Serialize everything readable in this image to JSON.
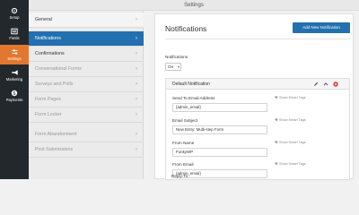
{
  "header": {
    "title": "Settings"
  },
  "rail": {
    "items": [
      {
        "label": "Setup",
        "icon": "gear-icon"
      },
      {
        "label": "Fields",
        "icon": "fields-icon"
      },
      {
        "label": "Settings",
        "icon": "sliders-icon"
      },
      {
        "label": "Marketing",
        "icon": "megaphone-icon"
      },
      {
        "label": "Payments",
        "icon": "dollar-icon"
      }
    ],
    "active_color": "#e27730",
    "background": "#23282d"
  },
  "subnav": {
    "items": [
      {
        "label": "General"
      },
      {
        "label": "Notifications"
      },
      {
        "label": "Confirmations"
      },
      {
        "label": "Conversational Forms"
      },
      {
        "label": "Surveys and Polls"
      },
      {
        "label": "Form Pages"
      },
      {
        "label": "Form Locker"
      },
      {
        "label": "Form Abandonment"
      },
      {
        "label": "Post Submissions"
      }
    ],
    "chevron": "›"
  },
  "main": {
    "title": "Notifications",
    "add_button": "Add New Notification",
    "notifications_label": "Notifications",
    "notifications_value": "On",
    "notification": {
      "title": "Default Notification",
      "smart_tags_label": "Show Smart Tags",
      "fields": [
        {
          "label": "Send To Email Address",
          "value": "{admin_email}"
        },
        {
          "label": "Email Subject",
          "value": "New Entry: Multi-step Form"
        },
        {
          "label": "From Name",
          "value": "FunkyWP"
        },
        {
          "label": "From Email",
          "value": "{admin_email}"
        },
        {
          "label": "Reply-To",
          "value": ""
        }
      ]
    }
  },
  "colors": {
    "primary": "#2270b0",
    "danger": "#d63638"
  }
}
